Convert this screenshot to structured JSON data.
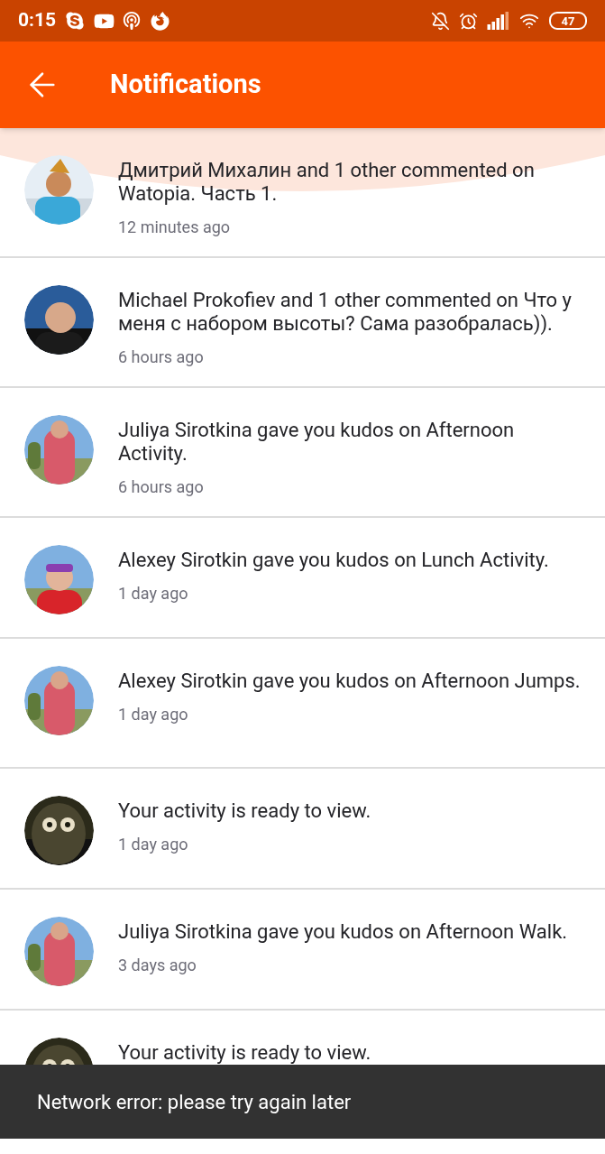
{
  "status_bar": {
    "time": "0:15",
    "battery": "47"
  },
  "app_bar": {
    "title": "Notifications"
  },
  "notifications": [
    {
      "text": "Дмитрий Михалин and 1 other commented on Watopia. Часть 1.",
      "time": "12 minutes ago"
    },
    {
      "text": "Michael Prokofiev and 1 other commented on Что у меня с набором высоты? Сама разобралась)).",
      "time": "6 hours ago"
    },
    {
      "text": "Juliya Sirotkina gave you kudos on Afternoon Activity.",
      "time": "6 hours ago"
    },
    {
      "text": "Alexey Sirotkin gave you kudos on Lunch Activity.",
      "time": "1 day ago"
    },
    {
      "text": "Alexey Sirotkin gave you kudos on Afternoon Jumps.",
      "time": "1 day ago"
    },
    {
      "text": "Your activity is ready to view.",
      "time": "1 day ago"
    },
    {
      "text": "Juliya Sirotkina gave you kudos on Afternoon Walk.",
      "time": "3 days ago"
    },
    {
      "text": "Your activity is ready to view."
    }
  ],
  "snackbar": {
    "message": "Network error: please try again later"
  }
}
